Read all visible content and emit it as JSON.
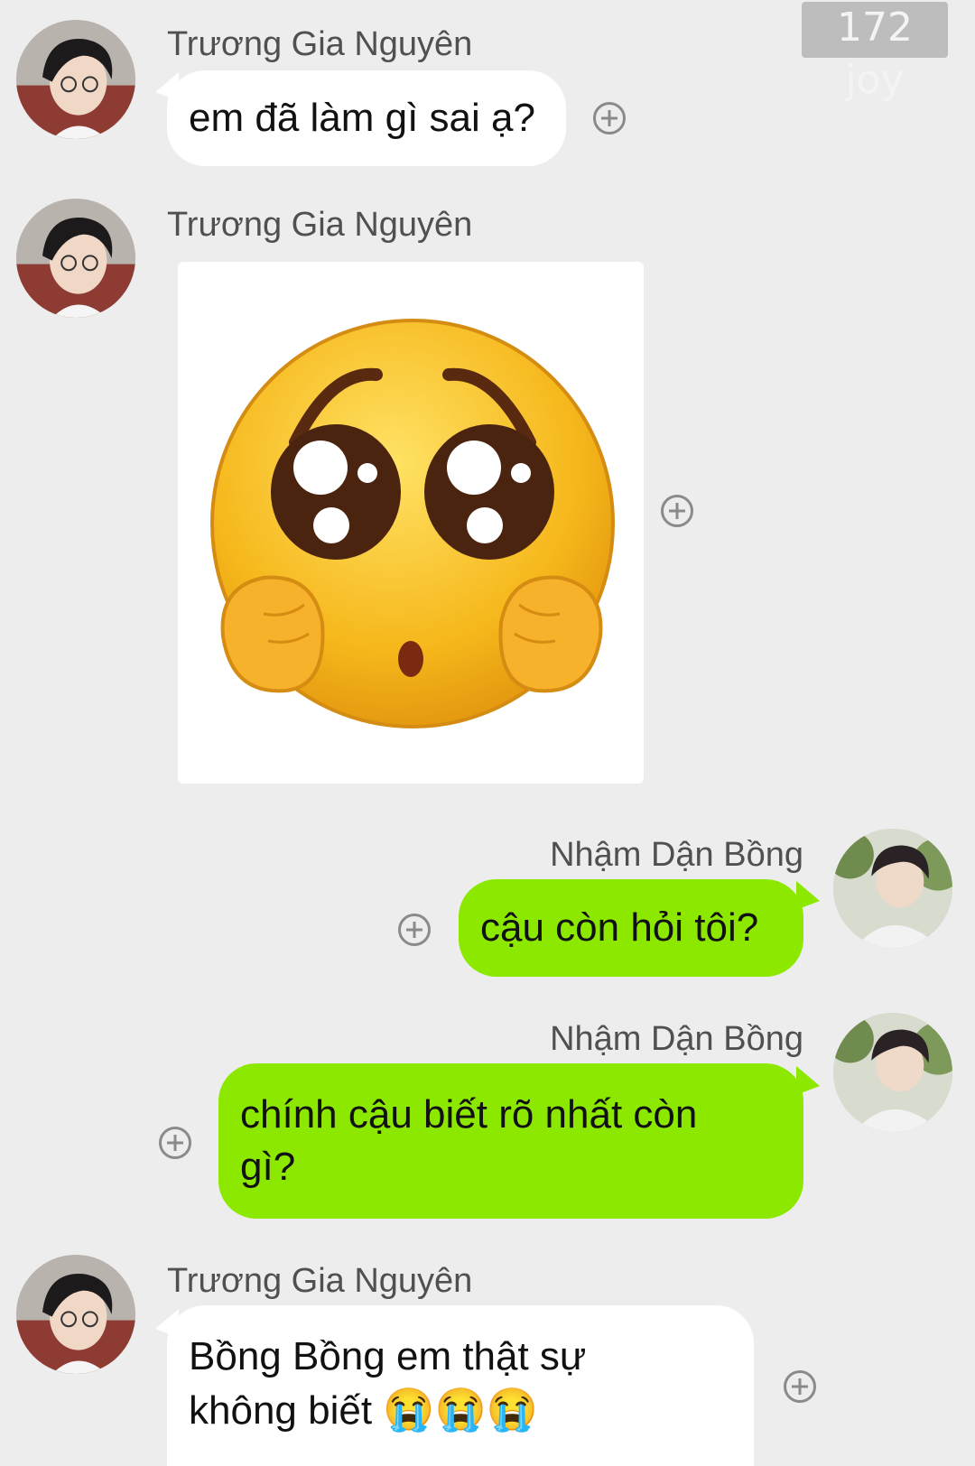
{
  "watermark": "172 joy",
  "messages": [
    {
      "sender": "Trương Gia Nguyên",
      "side": "left",
      "text": "em đã làm gì sai ạ?"
    },
    {
      "sender": "Trương Gia Nguyên",
      "side": "left",
      "type": "sticker",
      "sticker_icon": "pleading-face-sticker"
    },
    {
      "sender": "Nhậm Dận Bồng",
      "side": "right",
      "text": "cậu còn hỏi tôi?"
    },
    {
      "sender": "Nhậm Dận Bồng",
      "side": "right",
      "text_line1": "chính cậu biết rõ nhất còn",
      "text_line2": "gì?"
    },
    {
      "sender": "Trương Gia Nguyên",
      "side": "left",
      "text_line1": "Bồng Bồng em thật sự",
      "text_line2": "không biết",
      "emojis": "😭😭😭"
    }
  ],
  "icons": {
    "add": "plus-circle-icon",
    "avatar_left": "avatar-truong-gia-nguyen",
    "avatar_right": "avatar-nham-dan-bong"
  },
  "colors": {
    "background": "#ededed",
    "bubble_left": "#ffffff",
    "bubble_right": "#8de800"
  }
}
